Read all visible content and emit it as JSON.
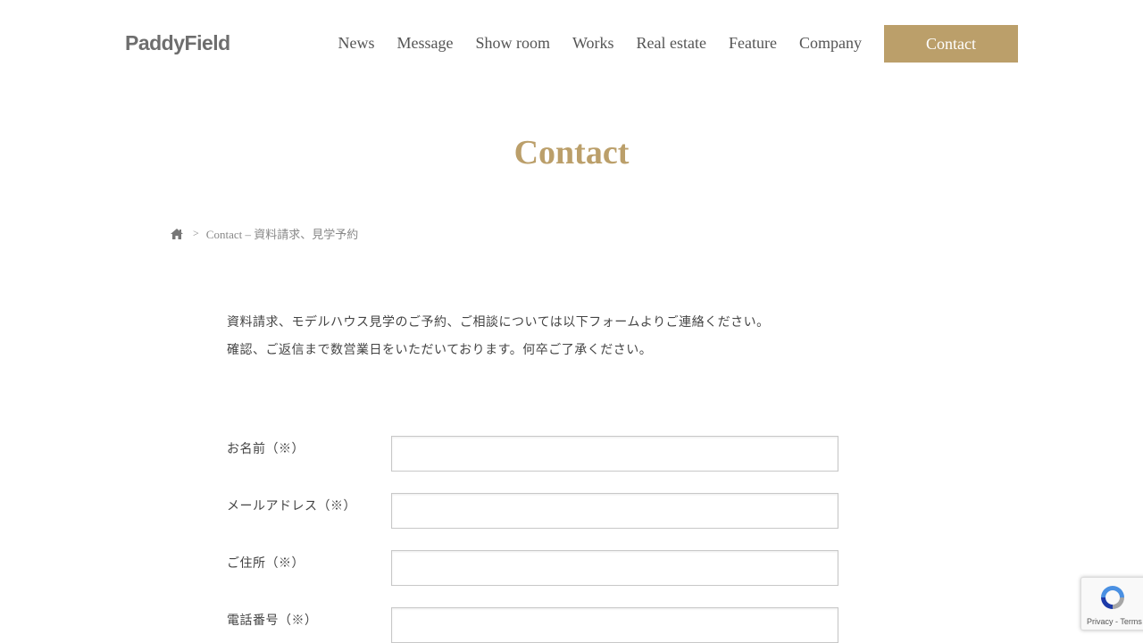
{
  "header": {
    "logo": "PaddyField",
    "nav": [
      "News",
      "Message",
      "Show room",
      "Works",
      "Real estate",
      "Feature",
      "Company"
    ],
    "contact_button": "Contact"
  },
  "page_title": "Contact",
  "breadcrumb": {
    "separator": ">",
    "current": "Contact – 資料請求、見学予約"
  },
  "intro": [
    "資料請求、モデルハウス見学のご予約、ご相談については以下フォームよりご連絡ください。",
    "確認、ご返信まで数営業日をいただいております。何卒ご了承ください。"
  ],
  "form": {
    "fields": [
      {
        "label": "お名前（※）",
        "value": ""
      },
      {
        "label": "メールアドレス（※）",
        "value": ""
      },
      {
        "label": "ご住所（※）",
        "value": ""
      },
      {
        "label": "電話番号（※）",
        "value": ""
      }
    ]
  },
  "recaptcha": {
    "links": "Privacy - Terms"
  },
  "colors": {
    "accent": "#bb9f6a",
    "text": "#555555"
  }
}
